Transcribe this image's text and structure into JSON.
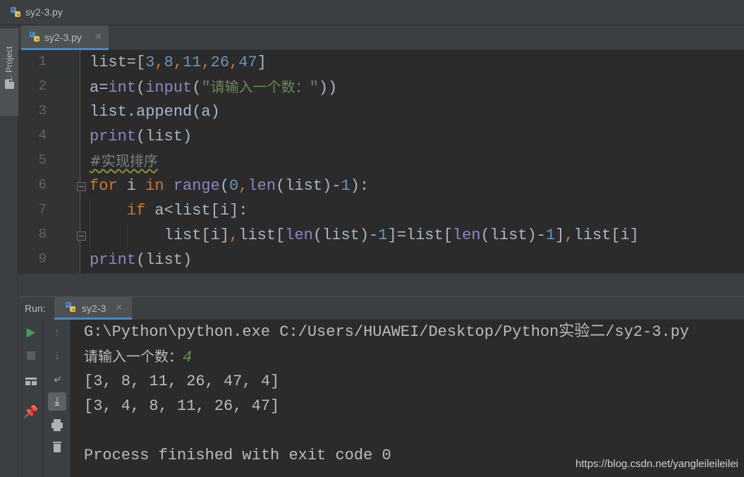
{
  "window": {
    "title": "sy2-3.py"
  },
  "sidebar": {
    "project_tab": "1: Project"
  },
  "editor": {
    "tab_label": "sy2-3.py",
    "line_numbers": [
      "1",
      "2",
      "3",
      "4",
      "5",
      "6",
      "7",
      "8",
      "9"
    ],
    "lines": [
      "list=[3,8,11,26,47]",
      "a=int(input(\"请输入一个数：\"))",
      "list.append(a)",
      "print(list)",
      "#实现排序",
      "for i in range(0,len(list)-1):",
      "    if a<list[i]:",
      "        list[i],list[len(list)-1]=list[len(list)-1],list[i]",
      "print(list)"
    ],
    "syntax_colors": {
      "keyword": "#cc7832",
      "builtin": "#8888c6",
      "number": "#6897bb",
      "string": "#6a8759",
      "comment": "#808080",
      "default": "#a9b7c6"
    }
  },
  "run_panel": {
    "label": "Run:",
    "tab_label": "sy2-3",
    "toolbar_icons": [
      "run-icon",
      "stop-icon",
      "layout-icon",
      "pin-icon",
      "up-arrow-icon",
      "down-arrow-icon",
      "soft-wrap-icon",
      "scroll-to-end-icon",
      "print-icon",
      "trash-icon"
    ],
    "console": {
      "command": "G:\\Python\\python.exe C:/Users/HUAWEI/Desktop/Python实验二/sy2-3.py",
      "prompt": "请输入一个数：",
      "user_input": "4",
      "output_1": "[3, 8, 11, 26, 47, 4]",
      "output_2": "[3, 4, 8, 11, 26, 47]",
      "exit_message": "Process finished with exit code 0"
    }
  },
  "watermark": "https://blog.csdn.net/yangleileileilei"
}
